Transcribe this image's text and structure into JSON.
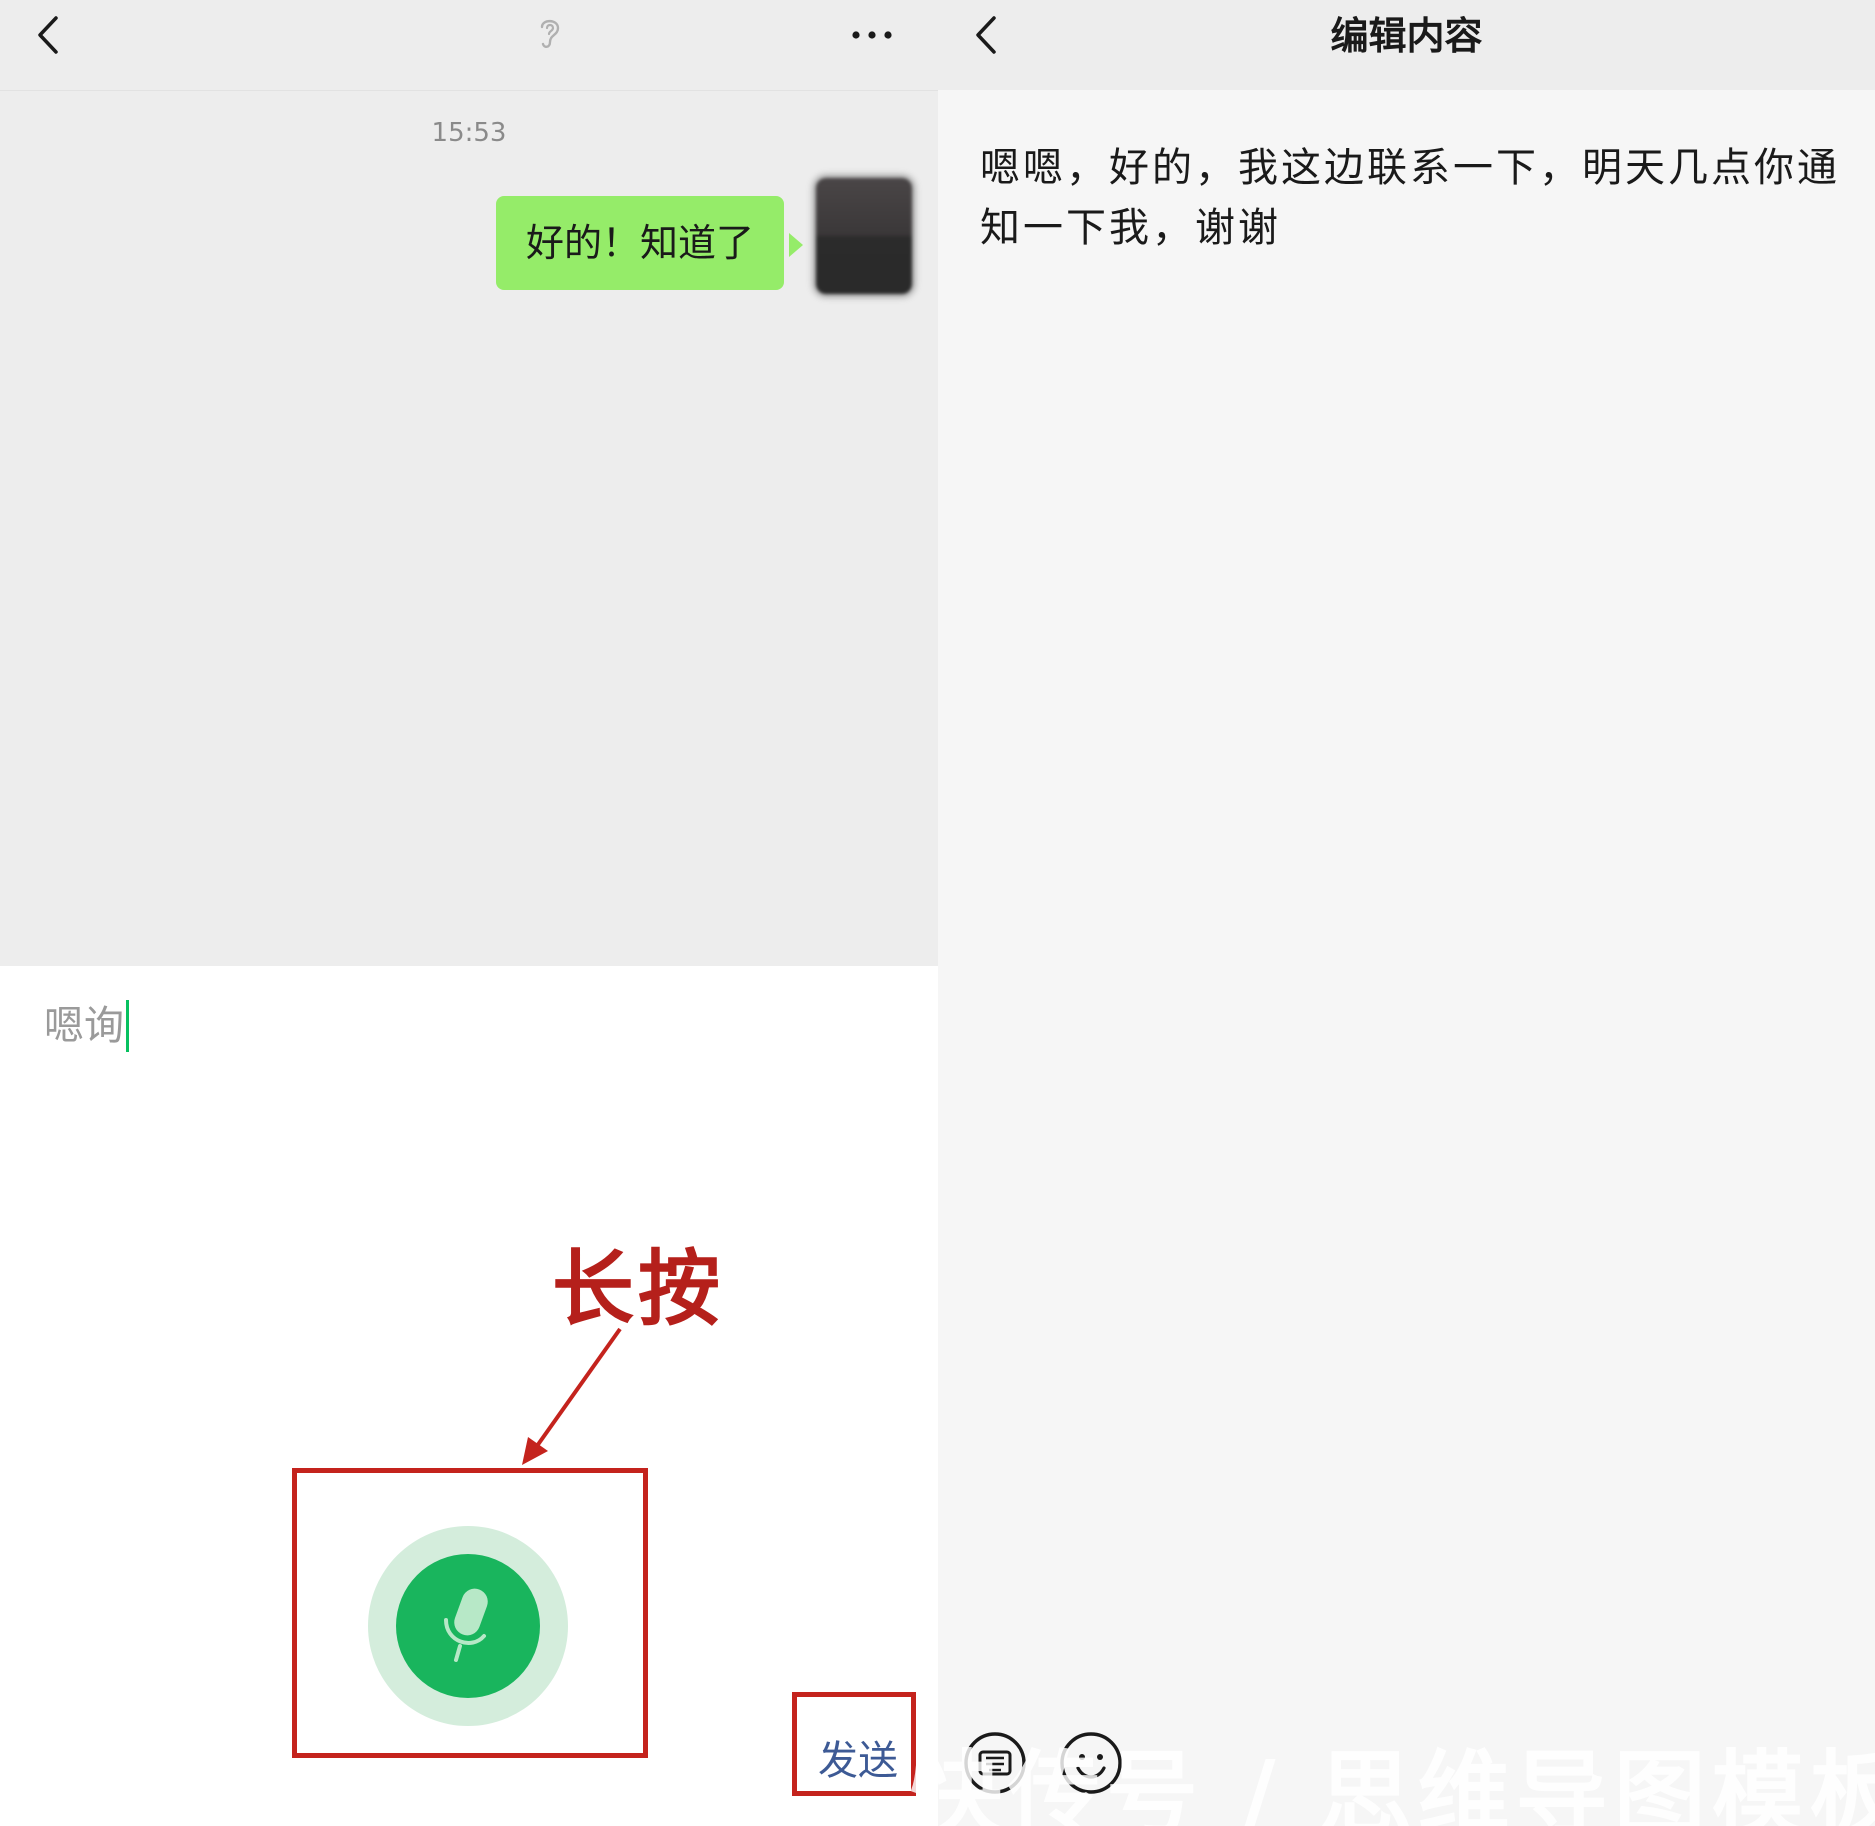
{
  "left_panel": {
    "header": {
      "back_icon": "chevron-left-icon",
      "ear_icon": "ear-icon",
      "more_icon": "more-dots-icon"
    },
    "chat": {
      "timestamp": "15:53",
      "messages": [
        {
          "sender": "self",
          "text": "好的！知道了"
        }
      ]
    },
    "input": {
      "text": "嗯询"
    },
    "annotation": {
      "label": "长按",
      "color": "#b5201b"
    },
    "voice_button": {
      "icon": "microphone-icon",
      "color": "#19b55d"
    }
  },
  "right_panel": {
    "header": {
      "back_icon": "chevron-left-icon",
      "title": "编辑内容"
    },
    "content": "嗯嗯，好的，我这边联系一下，明天几点你通知一下我，谢谢",
    "tools": {
      "keyboard_icon": "keyboard-icon",
      "emoji_icon": "emoji-icon"
    },
    "send_label": "发送"
  },
  "watermark": "快传号 / 思维导图模板",
  "colors": {
    "chat_bg": "#ededed",
    "bubble_green": "#95ec69",
    "accent_green": "#07c160",
    "annotation_red": "#c4231d",
    "send_blue": "#3d5a95"
  }
}
